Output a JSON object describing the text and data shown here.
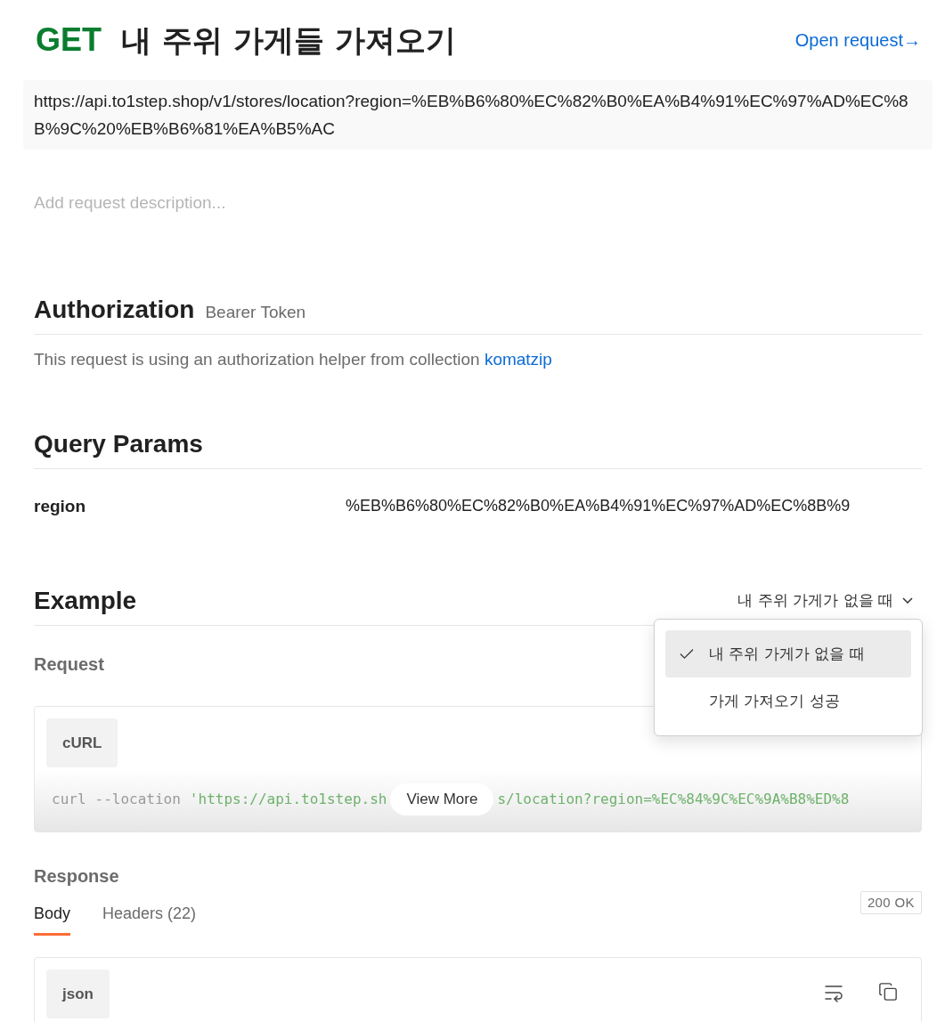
{
  "header": {
    "method": "GET",
    "title": "내 주위 가게들 가져오기",
    "open_link": "Open request→"
  },
  "url": "https://api.to1step.shop/v1/stores/location?region=%EB%B6%80%EC%82%B0%EA%B4%91%EC%97%AD%EC%8B%9C%20%EB%B6%81%EA%B5%AC",
  "description": {
    "placeholder": "Add request description..."
  },
  "authorization": {
    "heading": "Authorization",
    "type": "Bearer Token",
    "text": "This request is using an authorization helper from collection ",
    "collection_link": "komatzip"
  },
  "query_params": {
    "heading": "Query Params",
    "rows": [
      {
        "key": "region",
        "value": "%EB%B6%80%EC%82%B0%EA%B4%91%EC%97%AD%EC%8B%9"
      }
    ]
  },
  "example": {
    "heading": "Example",
    "selector": "내 주위 가게가 없을 때",
    "dropdown": [
      {
        "label": "내 주위 가게가 없을 때",
        "selected": true
      },
      {
        "label": "가게 가져오기 성공",
        "selected": false
      }
    ],
    "request": {
      "heading": "Request",
      "language": "cURL",
      "code_before": [
        {
          "kind": "command",
          "text": "curl"
        },
        {
          "kind": "flag",
          "text": "--location"
        },
        {
          "kind": "string",
          "text": "'https://api.to1step.sh"
        }
      ],
      "view_more": "View More",
      "code_after": [
        {
          "kind": "string",
          "text": "s/location?region=%EC%84%9C%EC%9A%B8%ED%8"
        }
      ]
    },
    "response": {
      "heading": "Response",
      "tabs": [
        {
          "label": "Body",
          "selected": true
        },
        {
          "label": "Headers (22)",
          "selected": false
        }
      ],
      "status": "200 OK",
      "language": "json"
    }
  }
}
